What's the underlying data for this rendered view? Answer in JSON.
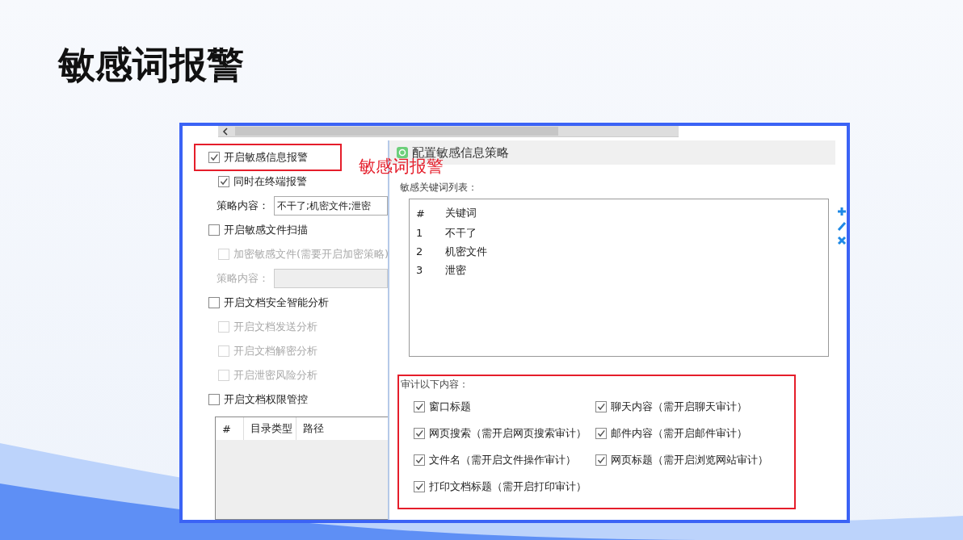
{
  "slide_title": "敏感词报警",
  "callout": "敏感词报警",
  "left_panel": {
    "items": [
      {
        "kind": "checkbox",
        "label": "开启敏感信息报警",
        "checked": true,
        "disabled": false,
        "highlighted": true,
        "children": [
          {
            "kind": "checkbox",
            "label": "同时在终端报警",
            "checked": true,
            "disabled": false
          },
          {
            "kind": "field",
            "label": "策略内容：",
            "value": "不干了;机密文件;泄密",
            "disabled": false
          }
        ]
      },
      {
        "kind": "checkbox",
        "label": "开启敏感文件扫描",
        "checked": false,
        "disabled": false,
        "highlighted": false,
        "children": [
          {
            "kind": "checkbox",
            "label": "加密敏感文件(需要开启加密策略)",
            "checked": false,
            "disabled": true
          },
          {
            "kind": "field",
            "label": "策略内容：",
            "disabled": true
          }
        ]
      },
      {
        "kind": "checkbox",
        "label": "开启文档安全智能分析",
        "checked": false,
        "disabled": false,
        "highlighted": false,
        "children": [
          {
            "kind": "checkbox",
            "label": "开启文档发送分析",
            "checked": false,
            "disabled": true
          },
          {
            "kind": "checkbox",
            "label": "开启文档解密分析",
            "checked": false,
            "disabled": true
          },
          {
            "kind": "checkbox",
            "label": "开启泄密风险分析",
            "checked": false,
            "disabled": true
          }
        ]
      },
      {
        "kind": "checkbox",
        "label": "开启文档权限管控",
        "checked": false,
        "disabled": false,
        "highlighted": false
      }
    ],
    "table": {
      "columns": [
        "#",
        "目录类型",
        "路径"
      ]
    }
  },
  "dialog": {
    "title": "配置敏感信息策略",
    "keyword_label": "敏感关键词列表：",
    "keyword_columns": [
      "#",
      "关键词"
    ],
    "keyword_rows": [
      [
        "1",
        "不干了"
      ],
      [
        "2",
        "机密文件"
      ],
      [
        "3",
        "泄密"
      ]
    ],
    "audit_label": "审计以下内容：",
    "audit_options": [
      {
        "label": "窗口标题",
        "checked": true
      },
      {
        "label": "聊天内容（需开启聊天审计）",
        "checked": true
      },
      {
        "label": "网页搜索（需开启网页搜索审计）",
        "checked": true
      },
      {
        "label": "邮件内容（需开启邮件审计）",
        "checked": true
      },
      {
        "label": "文件名（需开启文件操作审计）",
        "checked": true
      },
      {
        "label": "网页标题（需开启浏览网站审计）",
        "checked": true
      },
      {
        "label": "打印文档标题（需开启打印审计）",
        "checked": true
      }
    ]
  }
}
